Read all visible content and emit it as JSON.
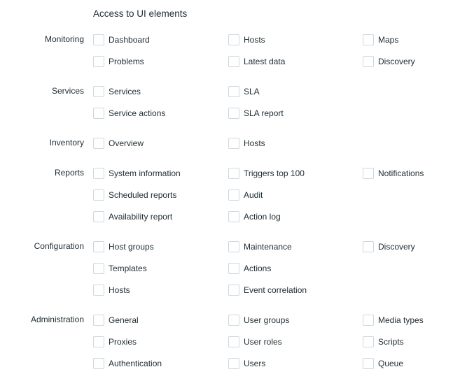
{
  "section": {
    "title": "Access to UI elements"
  },
  "checkbox_icon": "checkbox-unchecked-icon",
  "colors": {
    "text": "#1f2c33",
    "checkbox_border": "#cdd8df",
    "background": "#ffffff"
  },
  "groups": [
    {
      "label": "Monitoring",
      "rows": [
        [
          {
            "label": "Dashboard",
            "checked": false
          },
          {
            "label": "Hosts",
            "checked": false
          },
          {
            "label": "Maps",
            "checked": false
          }
        ],
        [
          {
            "label": "Problems",
            "checked": false
          },
          {
            "label": "Latest data",
            "checked": false
          },
          {
            "label": "Discovery",
            "checked": false
          }
        ]
      ]
    },
    {
      "label": "Services",
      "rows": [
        [
          {
            "label": "Services",
            "checked": false
          },
          {
            "label": "SLA",
            "checked": false
          }
        ],
        [
          {
            "label": "Service actions",
            "checked": false
          },
          {
            "label": "SLA report",
            "checked": false
          }
        ]
      ]
    },
    {
      "label": "Inventory",
      "rows": [
        [
          {
            "label": "Overview",
            "checked": false
          },
          {
            "label": "Hosts",
            "checked": false
          }
        ]
      ]
    },
    {
      "label": "Reports",
      "rows": [
        [
          {
            "label": "System information",
            "checked": false
          },
          {
            "label": "Triggers top 100",
            "checked": false
          },
          {
            "label": "Notifications",
            "checked": false
          }
        ],
        [
          {
            "label": "Scheduled reports",
            "checked": false
          },
          {
            "label": "Audit",
            "checked": false
          }
        ],
        [
          {
            "label": "Availability report",
            "checked": false
          },
          {
            "label": "Action log",
            "checked": false
          }
        ]
      ]
    },
    {
      "label": "Configuration",
      "rows": [
        [
          {
            "label": "Host groups",
            "checked": false
          },
          {
            "label": "Maintenance",
            "checked": false
          },
          {
            "label": "Discovery",
            "checked": false
          }
        ],
        [
          {
            "label": "Templates",
            "checked": false
          },
          {
            "label": "Actions",
            "checked": false
          }
        ],
        [
          {
            "label": "Hosts",
            "checked": false
          },
          {
            "label": "Event correlation",
            "checked": false
          }
        ]
      ]
    },
    {
      "label": "Administration",
      "rows": [
        [
          {
            "label": "General",
            "checked": false
          },
          {
            "label": "User groups",
            "checked": false
          },
          {
            "label": "Media types",
            "checked": false
          }
        ],
        [
          {
            "label": "Proxies",
            "checked": false
          },
          {
            "label": "User roles",
            "checked": false
          },
          {
            "label": "Scripts",
            "checked": false
          }
        ],
        [
          {
            "label": "Authentication",
            "checked": false
          },
          {
            "label": "Users",
            "checked": false
          },
          {
            "label": "Queue",
            "checked": false
          }
        ]
      ]
    }
  ]
}
